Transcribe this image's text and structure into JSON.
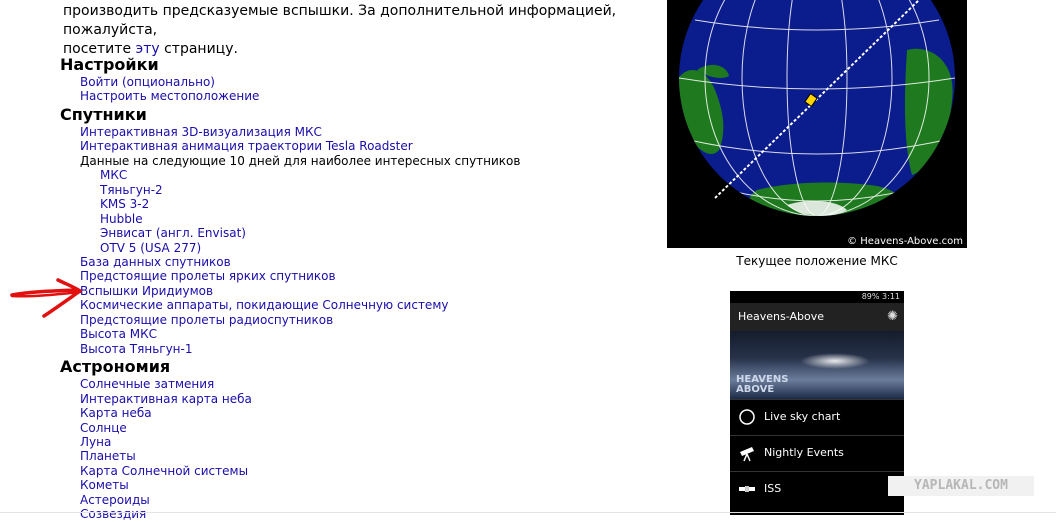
{
  "intro": {
    "line1": "производить предсказуемые вспышки. За дополнительной информацией, пожалуйста,",
    "line2_before": "посетите ",
    "line2_link": "эту",
    "line2_after": " страницу."
  },
  "sections": {
    "settings": {
      "title": "Настройки",
      "items": [
        "Войти (опционально)",
        "Настроить местоположение"
      ]
    },
    "satellites": {
      "title": "Спутники",
      "items_top": [
        "Интерактивная 3D-визуализация МКС",
        "Интерактивная анимация траектории Tesla Roadster"
      ],
      "subheader": "Данные на следующие 10 дней для наиболее интересных спутников",
      "sub_items": [
        "МКС",
        "Тяньгун-2",
        "KMS 3-2",
        "Hubble",
        "Энвисат (англ. Envisat)",
        "OTV 5 (USA 277)"
      ],
      "items_bottom": [
        "База данных спутников",
        "Предстоящие пролеты ярких спутников",
        "Вспышки Иридиумов",
        "Космические аппараты, покидающие Солнечную систему",
        "Предстоящие пролеты радиоспутников",
        "Высота МКС",
        "Высота Тяньгун-1"
      ]
    },
    "astronomy": {
      "title": "Астрономия",
      "items": [
        "Солнечные затмения",
        "Интерактивная карта неба",
        "Карта неба",
        "Солнце",
        "Луна",
        "Планеты",
        "Карта Солнечной системы",
        "Кометы",
        "Астероиды",
        "Созвездия"
      ]
    }
  },
  "globe": {
    "credit": "© Heavens-Above.com",
    "caption": "Текущее положение МКС"
  },
  "phone": {
    "status": "89%  3:11",
    "app_title": "Heavens-Above",
    "brand_line1": "HEAVENS",
    "brand_line2": "ABOVE",
    "menu": [
      {
        "label": "Live sky chart",
        "icon": "compass-icon"
      },
      {
        "label": "Nightly Events",
        "icon": "telescope-icon"
      },
      {
        "label": "ISS",
        "icon": "satellite-icon"
      }
    ]
  },
  "watermark": "YAPLAKAL.COM",
  "colors": {
    "link": "#1a0dab",
    "arrow": "#e31010",
    "ocean": "#0b1c8c",
    "land": "#1f7a1f"
  }
}
